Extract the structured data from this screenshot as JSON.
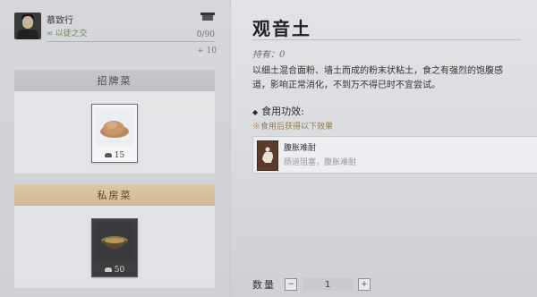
{
  "character": {
    "name": "慕致行",
    "status": "以徒之交",
    "progress_text": "0/90",
    "progress_fraction": 0,
    "bonus_text": "+ 10",
    "icons": {
      "avatar": "character-portrait",
      "food": "food-tray-icon"
    }
  },
  "sections": {
    "signature": {
      "label": "招牌菜",
      "item": {
        "price": "15",
        "price_icon": "coin-icon",
        "icon": "earth-powder-dish"
      }
    },
    "private": {
      "label": "私房菜",
      "item": {
        "price": "50",
        "price_icon": "coin-icon",
        "icon": "dark-bowl-dish"
      }
    }
  },
  "detail": {
    "title": "观音土",
    "owned_label": "持有：",
    "owned_value": "0",
    "description": "以细土混合面粉、墙土而成的粉末状粘土，食之有强烈的饱腹感\n道，影响正常消化，不到万不得已时不宜尝试。",
    "effect_heading": "食用功效:",
    "effect_subheading": "※食用后获得以下效果",
    "effect": {
      "name": "腹胀难耐",
      "text": "肠道阻塞，腹胀难耐"
    }
  },
  "quantity": {
    "label": "数量",
    "value": "1",
    "minus": "−",
    "plus": "+"
  },
  "colors": {
    "accent_gold": "#d2b993",
    "status_green": "#6c8a52"
  }
}
